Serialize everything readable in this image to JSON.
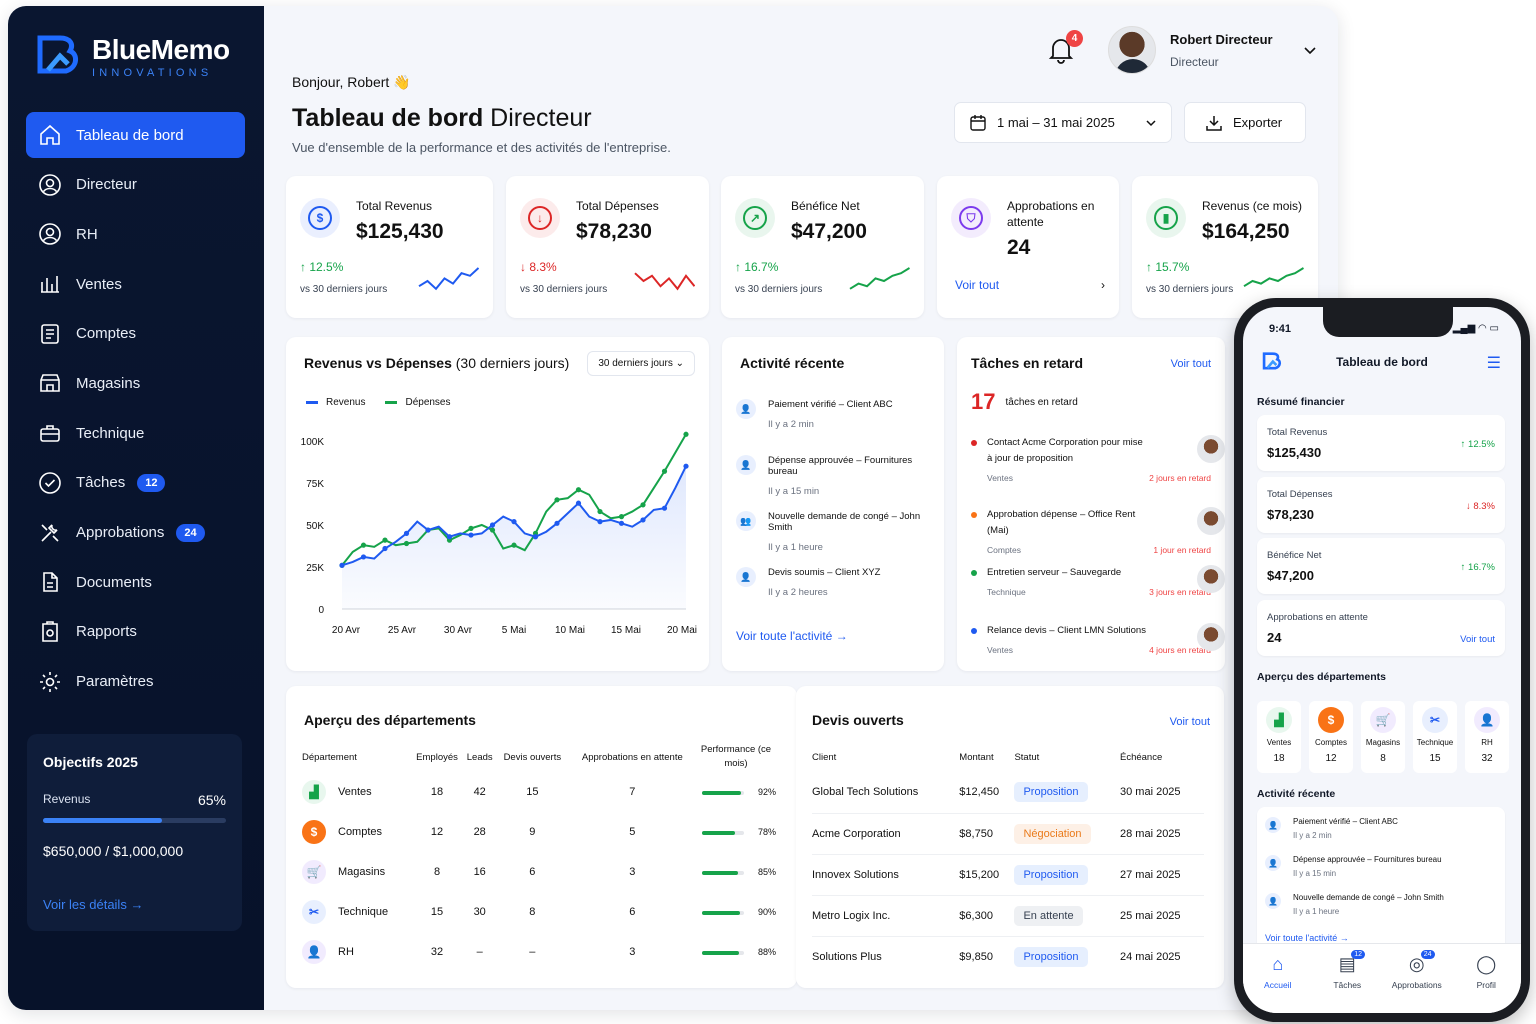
{
  "brand": {
    "name": "BlueMemo",
    "tagline": "INNOVATIONS"
  },
  "sidebar": {
    "items": [
      {
        "label": "Tableau de bord",
        "icon": "home-icon",
        "active": true
      },
      {
        "label": "Directeur",
        "icon": "user-circle-icon"
      },
      {
        "label": "RH",
        "icon": "user-circle-icon"
      },
      {
        "label": "Ventes",
        "icon": "bar-chart-icon"
      },
      {
        "label": "Comptes",
        "icon": "ledger-icon"
      },
      {
        "label": "Magasins",
        "icon": "store-icon"
      },
      {
        "label": "Technique",
        "icon": "toolbox-icon"
      },
      {
        "label": "Tâches",
        "icon": "check-circle-icon",
        "badge": "12"
      },
      {
        "label": "Approbations",
        "icon": "tools-icon",
        "badge": "24"
      },
      {
        "label": "Documents",
        "icon": "document-icon"
      },
      {
        "label": "Rapports",
        "icon": "report-icon"
      },
      {
        "label": "Paramètres",
        "icon": "gear-icon"
      }
    ],
    "goals": {
      "title": "Objectifs 2025",
      "metric": "Revenus",
      "percent": "65%",
      "progress": 0.65,
      "amount": "$650,000 / $1,000,000",
      "link": "Voir les détails"
    }
  },
  "header": {
    "greeting": "Bonjour, Robert 👋",
    "title_bold": "Tableau de bord",
    "title_rest": " Directeur",
    "subtitle": "Vue d'ensemble de la performance et des activités de l'entreprise.",
    "notifications": "4",
    "user_name": "Robert Directeur",
    "user_role": "Directeur",
    "date_range": "1 mai – 31 mai 2025",
    "export": "Exporter"
  },
  "stats": [
    {
      "label": "Total Revenus",
      "value": "$125,430",
      "change": "↑ 12.5%",
      "sub": "vs 30 derniers jours",
      "trend": "up",
      "color": "#1f5af0"
    },
    {
      "label": "Total Dépenses",
      "value": "$78,230",
      "change": "↓ 8.3%",
      "sub": "vs 30 derniers jours",
      "trend": "down",
      "color": "#dc2626"
    },
    {
      "label": "Bénéfice Net",
      "value": "$47,200",
      "change": "↑ 16.7%",
      "sub": "vs 30 derniers jours",
      "trend": "up",
      "color": "#16a34a"
    },
    {
      "label": "Approbations en attente",
      "value": "24",
      "link": "Voir tout",
      "color": "#7c3aed"
    },
    {
      "label": "Revenus (ce mois)",
      "value": "$164,250",
      "change": "↑ 15.7%",
      "sub": "vs 30 derniers jours",
      "trend": "up",
      "color": "#16a34a"
    }
  ],
  "revenue_chart": {
    "title": "Revenus vs Dépenses",
    "title_suffix": " (30 derniers jours)",
    "filter": "30 derniers jours",
    "chart_data": {
      "type": "line",
      "x": [
        "20 Avr",
        "21 Avr",
        "22 Avr",
        "23 Avr",
        "24 Avr",
        "25 Avr",
        "26 Avr",
        "27 Avr",
        "28 Avr",
        "29 Avr",
        "30 Avr",
        "1 Mai",
        "2 Mai",
        "3 Mai",
        "4 Mai",
        "5 Mai",
        "6 Mai",
        "7 Mai",
        "8 Mai",
        "9 Mai",
        "10 Mai",
        "11 Mai",
        "12 Mai",
        "13 Mai",
        "14 Mai",
        "15 Mai",
        "16 Mai",
        "17 Mai",
        "18 Mai",
        "19 Mai",
        "20 Mai"
      ],
      "xticks": [
        "20 Avr",
        "25 Avr",
        "30 Avr",
        "5 Mai",
        "10 Mai",
        "15 Mai",
        "20 Mai"
      ],
      "yticks": [
        "0",
        "25K",
        "50K",
        "75K",
        "100K"
      ],
      "ylim": [
        0,
        100000
      ],
      "series": [
        {
          "name": "Revenus",
          "color": "#1f5af0",
          "values": [
            26000,
            28000,
            31000,
            30000,
            36000,
            40000,
            45000,
            52000,
            47000,
            49000,
            43000,
            45000,
            44000,
            45000,
            50000,
            55000,
            52000,
            45000,
            43000,
            46000,
            51000,
            57000,
            63000,
            55000,
            52000,
            53000,
            51000,
            49000,
            53000,
            59000,
            60000,
            72000,
            85000
          ]
        },
        {
          "name": "Dépenses",
          "color": "#16a34a",
          "values": [
            26000,
            34000,
            38000,
            37000,
            41000,
            38000,
            39000,
            40000,
            47000,
            48000,
            41000,
            44000,
            48000,
            50000,
            47000,
            36000,
            38000,
            35000,
            45000,
            58000,
            65000,
            66000,
            71000,
            68000,
            58000,
            54000,
            55000,
            58000,
            62000,
            72000,
            82000,
            93000,
            104000
          ]
        }
      ]
    }
  },
  "activity": {
    "title": "Activité récente",
    "items": [
      {
        "text": "Paiement vérifié – Client ABC",
        "time": "Il y a 2 min",
        "icon": "user-icon"
      },
      {
        "text": "Dépense approuvée – Fournitures bureau",
        "time": "Il y a 15 min",
        "icon": "user-icon"
      },
      {
        "text": "Nouvelle demande de congé – John Smith",
        "time": "Il y a 1 heure",
        "icon": "users-icon"
      },
      {
        "text": "Devis soumis – Client XYZ",
        "time": "Il y a 2 heures",
        "icon": "user-icon"
      }
    ],
    "link": "Voir toute l'activité"
  },
  "late_tasks": {
    "title": "Tâches en retard",
    "link": "Voir tout",
    "count": "17",
    "count_label": "tâches en retard",
    "items": [
      {
        "text": "Contact Acme Corporation pour mise à jour de proposition",
        "dept": "Ventes",
        "late": "2 jours en retard",
        "color": "#dc2626"
      },
      {
        "text": "Approbation dépense – Office Rent (Mai)",
        "dept": "Comptes",
        "late": "1 jour en retard",
        "color": "#f97316"
      },
      {
        "text": "Entretien serveur – Sauvegarde",
        "dept": "Technique",
        "late": "3 jours en retard",
        "color": "#16a34a"
      },
      {
        "text": "Relance devis – Client LMN Solutions",
        "dept": "Ventes",
        "late": "4 jours en retard",
        "color": "#1f5af0"
      }
    ]
  },
  "departments": {
    "title": "Aperçu des départements",
    "headers": [
      "Département",
      "Employés",
      "Leads",
      "Devis ouverts",
      "Approbations en attente",
      "Performance (ce mois)"
    ],
    "rows": [
      {
        "name": "Ventes",
        "icon": "bar-chart-icon",
        "color": "#16a34a",
        "bg": "#e8f7ee",
        "employees": "18",
        "leads": "42",
        "quotes": "15",
        "approvals": "7",
        "perf": "92%",
        "perf_value": 0.92
      },
      {
        "name": "Comptes",
        "icon": "dollar-icon",
        "color": "#ffffff",
        "bg": "#f97316",
        "employees": "12",
        "leads": "28",
        "quotes": "9",
        "approvals": "5",
        "perf": "78%",
        "perf_value": 0.78
      },
      {
        "name": "Magasins",
        "icon": "cart-icon",
        "color": "#7c3aed",
        "bg": "#f1ebfe",
        "employees": "8",
        "leads": "16",
        "quotes": "6",
        "approvals": "3",
        "perf": "85%",
        "perf_value": 0.85
      },
      {
        "name": "Technique",
        "icon": "tools-icon",
        "color": "#1f5af0",
        "bg": "#e8effe",
        "employees": "15",
        "leads": "30",
        "quotes": "8",
        "approvals": "6",
        "perf": "90%",
        "perf_value": 0.9
      },
      {
        "name": "RH",
        "icon": "users-icon",
        "color": "#7c3aed",
        "bg": "#f1ebfe",
        "employees": "32",
        "leads": "–",
        "quotes": "–",
        "approvals": "3",
        "perf": "88%",
        "perf_value": 0.88
      }
    ]
  },
  "quotes": {
    "title": "Devis ouverts",
    "link": "Voir tout",
    "headers": [
      "Client",
      "Montant",
      "Statut",
      "Échéance"
    ],
    "rows": [
      {
        "client": "Global Tech Solutions",
        "amount": "$12,450",
        "status": "Proposition",
        "kind": "blue",
        "due": "30 mai 2025"
      },
      {
        "client": "Acme Corporation",
        "amount": "$8,750",
        "status": "Négociation",
        "kind": "or",
        "due": "28 mai 2025"
      },
      {
        "client": "Innovex Solutions",
        "amount": "$15,200",
        "status": "Proposition",
        "kind": "blue",
        "due": "27 mai 2025"
      },
      {
        "client": "Metro Logix Inc.",
        "amount": "$6,300",
        "status": "En attente",
        "kind": "gr",
        "due": "25 mai 2025"
      },
      {
        "client": "Solutions Plus",
        "amount": "$9,850",
        "status": "Proposition",
        "kind": "blue",
        "due": "24 mai 2025"
      }
    ]
  },
  "mobile": {
    "time": "9:41",
    "title": "Tableau de bord",
    "summary_title": "Résumé financier",
    "cards": [
      {
        "label": "Total Revenus",
        "value": "$125,430",
        "change": "↑ 12.5%",
        "trend": "up"
      },
      {
        "label": "Total Dépenses",
        "value": "$78,230",
        "change": "↓ 8.3%",
        "trend": "down"
      },
      {
        "label": "Bénéfice Net",
        "value": "$47,200",
        "change": "↑ 16.7%",
        "trend": "up"
      },
      {
        "label": "Approbations en attente",
        "value": "24",
        "link": "Voir tout"
      }
    ],
    "dept_title": "Aperçu des départements",
    "depts": [
      {
        "name": "Ventes",
        "count": "18"
      },
      {
        "name": "Comptes",
        "count": "12"
      },
      {
        "name": "Magasins",
        "count": "8"
      },
      {
        "name": "Technique",
        "count": "15"
      },
      {
        "name": "RH",
        "count": "32"
      }
    ],
    "activity_title": "Activité récente",
    "activity": [
      {
        "text": "Paiement vérifié – Client ABC",
        "time": "Il y a 2 min"
      },
      {
        "text": "Dépense approuvée – Fournitures bureau",
        "time": "Il y a 15 min"
      },
      {
        "text": "Nouvelle demande de congé – John Smith",
        "time": "Il y a 1 heure"
      }
    ],
    "activity_link": "Voir toute l'activité",
    "tabs": [
      {
        "label": "Accueil",
        "icon": "home-icon",
        "active": true
      },
      {
        "label": "Tâches",
        "icon": "clipboard-icon",
        "badge": "12"
      },
      {
        "label": "Approbations",
        "icon": "check-circle-icon",
        "badge": "24"
      },
      {
        "label": "Profil",
        "icon": "user-icon"
      }
    ]
  }
}
